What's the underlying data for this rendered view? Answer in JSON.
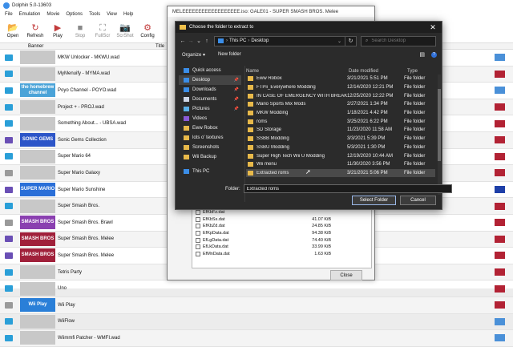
{
  "dolphin": {
    "title": "Dolphin 5.0-13603",
    "menu": [
      "File",
      "Emulation",
      "Movie",
      "Options",
      "Tools",
      "View",
      "Help"
    ],
    "toolbar": [
      {
        "label": "Open",
        "icon": "open-icon",
        "glyph": "📂",
        "disabled": false
      },
      {
        "label": "Refresh",
        "icon": "refresh-icon",
        "glyph": "↻",
        "disabled": false
      },
      {
        "label": "Play",
        "icon": "play-icon",
        "glyph": "▶",
        "disabled": false
      },
      {
        "label": "Stop",
        "icon": "stop-icon",
        "glyph": "■",
        "disabled": true
      },
      {
        "label": "FullScr",
        "icon": "fullscreen-icon",
        "glyph": "⛶",
        "disabled": true
      },
      {
        "label": "ScrShot",
        "icon": "screenshot-icon",
        "glyph": "📷",
        "disabled": true
      },
      {
        "label": "Config",
        "icon": "config-icon",
        "glyph": "⚙",
        "disabled": false
      }
    ],
    "columns": {
      "banner": "Banner",
      "title": "Title"
    },
    "games": [
      {
        "title": "MKW Unlocker - MKWU.wad",
        "banner": "",
        "platform_color": "#2a9fd8",
        "banner_color": "#c8c8c8",
        "flag": "un"
      },
      {
        "title": "MyMenuify - MYMA.wad",
        "banner": "",
        "platform_color": "#2a9fd8",
        "banner_color": "#c8c8c8",
        "flag": "us"
      },
      {
        "title": "Poyo Channel - POYO.wad",
        "banner": "the homebrew channel",
        "platform_color": "#2a9fd8",
        "banner_color": "#4aa3d8",
        "flag": "un"
      },
      {
        "title": "Project + - PROJ.wad",
        "banner": "",
        "platform_color": "#2a9fd8",
        "banner_color": "#c8c8c8",
        "flag": "us"
      },
      {
        "title": "Something About... - UBSA.wad",
        "banner": "",
        "platform_color": "#2a9fd8",
        "banner_color": "#c8c8c8",
        "flag": "us"
      },
      {
        "title": "Sonic Gems Collection",
        "banner": "SONIC GEMS",
        "platform_color": "#6a4fb5",
        "banner_color": "#2c55c8",
        "flag": "us"
      },
      {
        "title": "Super Mario 64",
        "banner": "",
        "platform_color": "#2a9fd8",
        "banner_color": "#c8c8c8",
        "flag": "us"
      },
      {
        "title": "Super Mario Galaxy",
        "banner": "",
        "platform_color": "#9a9a9a",
        "banner_color": "#c8c8c8",
        "flag": "us"
      },
      {
        "title": "Super Mario Sunshine",
        "banner": "SUPER MARIO",
        "platform_color": "#6a4fb5",
        "banner_color": "#2a6fd8",
        "flag": "eu"
      },
      {
        "title": "Super Smash Bros.",
        "banner": "",
        "platform_color": "#2a9fd8",
        "banner_color": "#c8c8c8",
        "flag": "us"
      },
      {
        "title": "Super Smash Bros. Brawl",
        "banner": "SMASH BROS",
        "platform_color": "#9a9a9a",
        "banner_color": "#8a3fb0",
        "flag": "us"
      },
      {
        "title": "Super Smash Bros. Melee",
        "banner": "SMASH BROS",
        "platform_color": "#6a4fb5",
        "banner_color": "#a0203a",
        "flag": "us"
      },
      {
        "title": "Super Smash Bros. Melee",
        "banner": "SMASH BROS",
        "platform_color": "#6a4fb5",
        "banner_color": "#a0203a",
        "flag": "us"
      },
      {
        "title": "Tetris Party",
        "banner": "",
        "platform_color": "#2a9fd8",
        "banner_color": "#c8c8c8",
        "flag": "us"
      },
      {
        "title": "Uno",
        "banner": "",
        "platform_color": "#2a9fd8",
        "banner_color": "#c8c8c8",
        "flag": "us"
      },
      {
        "title": "Wii Play",
        "banner": "Wii Play",
        "platform_color": "#9a9a9a",
        "banner_color": "#2a7fd8",
        "flag": "us"
      },
      {
        "title": "WiiFlow",
        "banner": "",
        "platform_color": "#2a9fd8",
        "banner_color": "#c8c8c8",
        "flag": "un"
      },
      {
        "title": "Wiimmfi Patcher - WMFI.wad",
        "banner": "",
        "platform_color": "#2a9fd8",
        "banner_color": "#c8c8c8",
        "flag": "un"
      }
    ]
  },
  "archive_window": {
    "title": "MELEEEEEEEEEEEEEEEEEE.iso: GALE01 - SUPER SMASH BROS. Melee",
    "files": [
      {
        "name": "EfKbFz.dat",
        "size": ""
      },
      {
        "name": "EfKbSs.dat",
        "size": "41.07 KiB"
      },
      {
        "name": "EfKbZd.dat",
        "size": "24.85 KiB"
      },
      {
        "name": "EfKpData.dat",
        "size": "94.38 KiB"
      },
      {
        "name": "EfLgData.dat",
        "size": "74.40 KiB"
      },
      {
        "name": "EfLkData.dat",
        "size": "33.99 KiB"
      },
      {
        "name": "EfMnData.dat",
        "size": "1.63 KiB"
      }
    ],
    "close_label": "Close"
  },
  "dialog": {
    "title": "Choose the folder to extract to",
    "close_glyph": "✕",
    "nav": {
      "back": "←",
      "forward": "→",
      "recent": "⌄",
      "up": "↑"
    },
    "path": [
      "This PC",
      "Desktop"
    ],
    "search_placeholder": "Search Desktop",
    "organize": "Organize ▾",
    "new_folder": "New folder",
    "help": "?",
    "nav_pane": [
      {
        "label": "Quick access",
        "icon": "star-icon",
        "color": "#3b8ee8",
        "pinned": false,
        "selected": false
      },
      {
        "label": "Desktop",
        "icon": "desktop-icon",
        "color": "#3b8ee8",
        "pinned": true,
        "selected": true
      },
      {
        "label": "Downloads",
        "icon": "download-icon",
        "color": "#3b8ee8",
        "pinned": true,
        "selected": false
      },
      {
        "label": "Documents",
        "icon": "documents-icon",
        "color": "#cfd7e6",
        "pinned": true,
        "selected": false
      },
      {
        "label": "Pictures",
        "icon": "pictures-icon",
        "color": "#5ab0e8",
        "pinned": true,
        "selected": false
      },
      {
        "label": "Videos",
        "icon": "videos-icon",
        "color": "#8a5ad8",
        "pinned": false,
        "selected": false
      },
      {
        "label": "Eww Robox",
        "icon": "folder-icon",
        "color": "#e8b94a",
        "pinned": false,
        "selected": false
      },
      {
        "label": "lots o' textures",
        "icon": "folder-icon",
        "color": "#e8b94a",
        "pinned": false,
        "selected": false
      },
      {
        "label": "Screenshots",
        "icon": "folder-icon",
        "color": "#e8b94a",
        "pinned": false,
        "selected": false
      },
      {
        "label": "Wii Backup",
        "icon": "folder-icon",
        "color": "#e8b94a",
        "pinned": false,
        "selected": false
      }
    ],
    "this_pc": "This PC",
    "columns": {
      "name": "Name",
      "date": "Date modified",
      "type": "Type"
    },
    "files": [
      {
        "name": "Eww Robox",
        "date": "3/21/2021 5:51 PM",
        "type": "File folder"
      },
      {
        "name": "FTPii_Everywhere Modding",
        "date": "12/14/2020 12:21 PM",
        "type": "File folder"
      },
      {
        "name": "IN CASE OF EMERGENCY WITH BREAK G...",
        "date": "12/25/2020 12:22 PM",
        "type": "File folder"
      },
      {
        "name": "Mario Sports Mix Mods",
        "date": "2/27/2021 1:34 PM",
        "type": "File folder"
      },
      {
        "name": "MKW Modding",
        "date": "1/18/2021 4:42 PM",
        "type": "File folder"
      },
      {
        "name": "roms",
        "date": "3/25/2021 6:22 PM",
        "type": "File folder"
      },
      {
        "name": "SD Storage",
        "date": "11/23/2020 11:58 AM",
        "type": "File folder"
      },
      {
        "name": "SSBB Modding",
        "date": "3/3/2021 5:39 PM",
        "type": "File folder"
      },
      {
        "name": "SSBU Modding",
        "date": "5/3/2021 1:30 PM",
        "type": "File folder"
      },
      {
        "name": "Super High Tech Wii U Modding",
        "date": "12/19/2020 10:44 AM",
        "type": "File folder"
      },
      {
        "name": "Wii menu",
        "date": "11/30/2020 3:56 PM",
        "type": "File folder"
      },
      {
        "name": "Extracted roms",
        "date": "3/21/2021 5:06 PM",
        "type": "File folder"
      }
    ],
    "selected_index": 11,
    "folder_label": "Folder:",
    "folder_value": "Extracted roms",
    "select_label": "Select Folder",
    "cancel_label": "Cancel"
  }
}
